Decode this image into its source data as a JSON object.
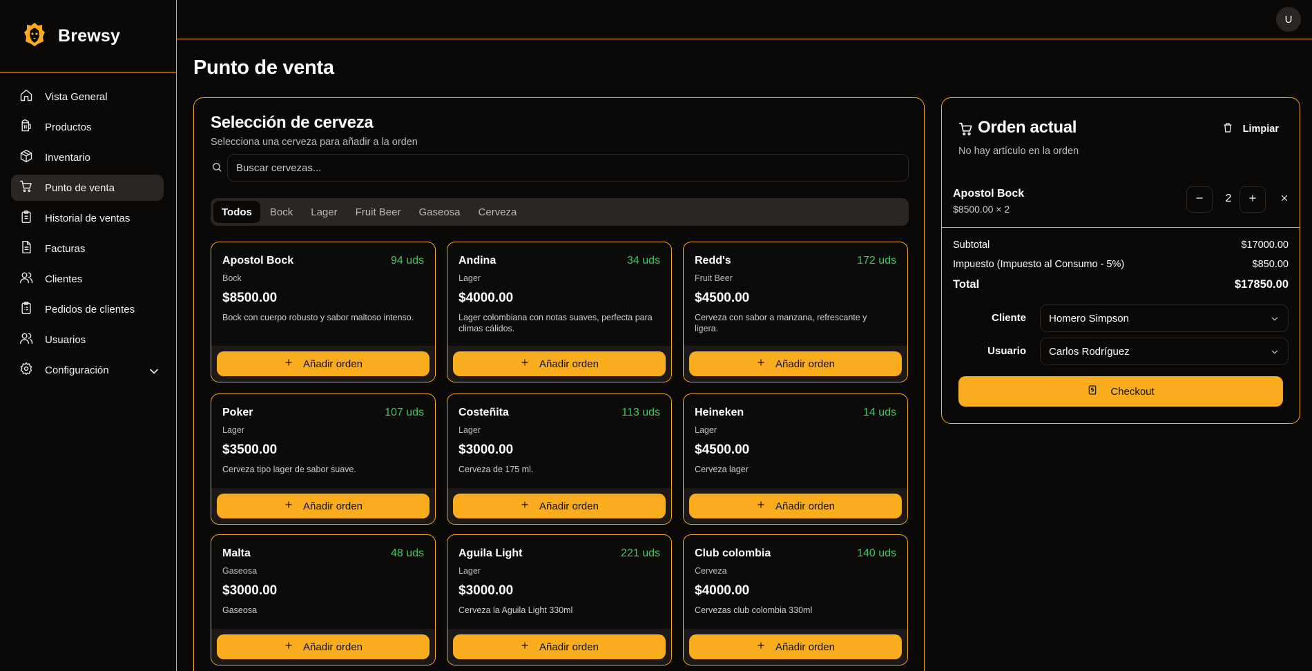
{
  "brand": {
    "name": "Brewsy",
    "logo_icon": "lion-icon",
    "accent": "#f8ac1e"
  },
  "sidebar": {
    "items": [
      {
        "label": "Vista General",
        "icon": "home-icon"
      },
      {
        "label": "Productos",
        "icon": "beer-mug-icon"
      },
      {
        "label": "Inventario",
        "icon": "box-icon"
      },
      {
        "label": "Punto de venta",
        "icon": "cart-icon",
        "active": true
      },
      {
        "label": "Historial de ventas",
        "icon": "clipboard-icon"
      },
      {
        "label": "Facturas",
        "icon": "file-icon"
      },
      {
        "label": "Clientes",
        "icon": "users-icon"
      },
      {
        "label": "Pedidos de clientes",
        "icon": "clipboard-list-icon"
      },
      {
        "label": "Usuarios",
        "icon": "users-icon"
      },
      {
        "label": "Configuración",
        "icon": "gear-icon"
      }
    ]
  },
  "header": {
    "avatar_initial": "U"
  },
  "page": {
    "title": "Punto de venta"
  },
  "beers": {
    "title": "Selección de cerveza",
    "subtitle": "Selecciona una cerveza para añadir a la orden",
    "search_placeholder": "Buscar cervezas...",
    "tabs": [
      "Todos",
      "Bock",
      "Lager",
      "Fruit Beer",
      "Gaseosa",
      "Cerveza"
    ],
    "add_label": "Añadir orden",
    "products": [
      {
        "name": "Apostol Bock",
        "stock": "94 uds",
        "category": "Bock",
        "price": "$8500.00",
        "description": "Bock con cuerpo robusto y sabor maltoso intenso."
      },
      {
        "name": "Andina",
        "stock": "34 uds",
        "category": "Lager",
        "price": "$4000.00",
        "description": "Lager colombiana con notas suaves, perfecta para climas cálidos."
      },
      {
        "name": "Redd's",
        "stock": "172 uds",
        "category": "Fruit Beer",
        "price": "$4500.00",
        "description": "Cerveza con sabor a manzana, refrescante y ligera."
      },
      {
        "name": "Poker",
        "stock": "107 uds",
        "category": "Lager",
        "price": "$3500.00",
        "description": "Cerveza tipo lager de sabor suave."
      },
      {
        "name": "Costeñita",
        "stock": "113 uds",
        "category": "Lager",
        "price": "$3000.00",
        "description": "Cerveza de 175 ml."
      },
      {
        "name": "Heineken",
        "stock": "14 uds",
        "category": "Lager",
        "price": "$4500.00",
        "description": "Cerveza lager"
      },
      {
        "name": "Malta",
        "stock": "48 uds",
        "category": "Gaseosa",
        "price": "$3000.00",
        "description": "Gaseosa"
      },
      {
        "name": "Aguila Light",
        "stock": "221 uds",
        "category": "Lager",
        "price": "$3000.00",
        "description": "Cerveza la Aguila Light 330ml"
      },
      {
        "name": "Club colombia",
        "stock": "140 uds",
        "category": "Cerveza",
        "price": "$4000.00",
        "description": "Cervezas club colombia 330ml"
      }
    ]
  },
  "order": {
    "title": "Orden actual",
    "clear_label": "Limpiar",
    "empty_text": "No hay artículo en la orden",
    "item": {
      "name": "Apostol Bock",
      "detail": "$8500.00 × 2",
      "quantity": "2"
    },
    "summary": {
      "subtotal_label": "Subtotal",
      "subtotal": "$17000.00",
      "tax_label": "Impuesto (Impuesto al Consumo - 5%)",
      "tax": "$850.00",
      "total_label": "Total",
      "total": "$17850.00"
    },
    "client_label": "Cliente",
    "client_value": "Homero Simpson",
    "user_label": "Usuario",
    "user_value": "Carlos Rodríguez",
    "checkout_label": "Checkout"
  }
}
